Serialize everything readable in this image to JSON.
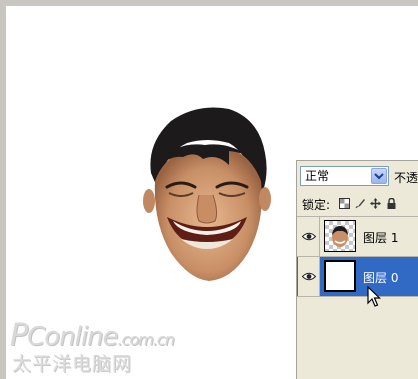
{
  "watermark": {
    "brand_prefix": "P",
    "brand_rest": "Conline",
    "domain": ".com.cn",
    "subtitle": "太平洋电脑网"
  },
  "layers_panel": {
    "blend_mode": "正常",
    "opacity_label": "不透",
    "lock_label": "锁定:",
    "lock_icons": [
      "lock-transparent-icon",
      "lock-paint-icon",
      "lock-move-icon",
      "lock-all-icon"
    ],
    "layers": [
      {
        "name": "图层 1",
        "visible": true,
        "selected": false,
        "thumbnail": "face-thumbnail"
      },
      {
        "name": "图层 0",
        "visible": true,
        "selected": true,
        "thumbnail": "white-thumbnail"
      }
    ]
  },
  "colors": {
    "selection": "#316ac5",
    "panel_bg": "#ece9d8",
    "frame": "#c9c6c2"
  }
}
